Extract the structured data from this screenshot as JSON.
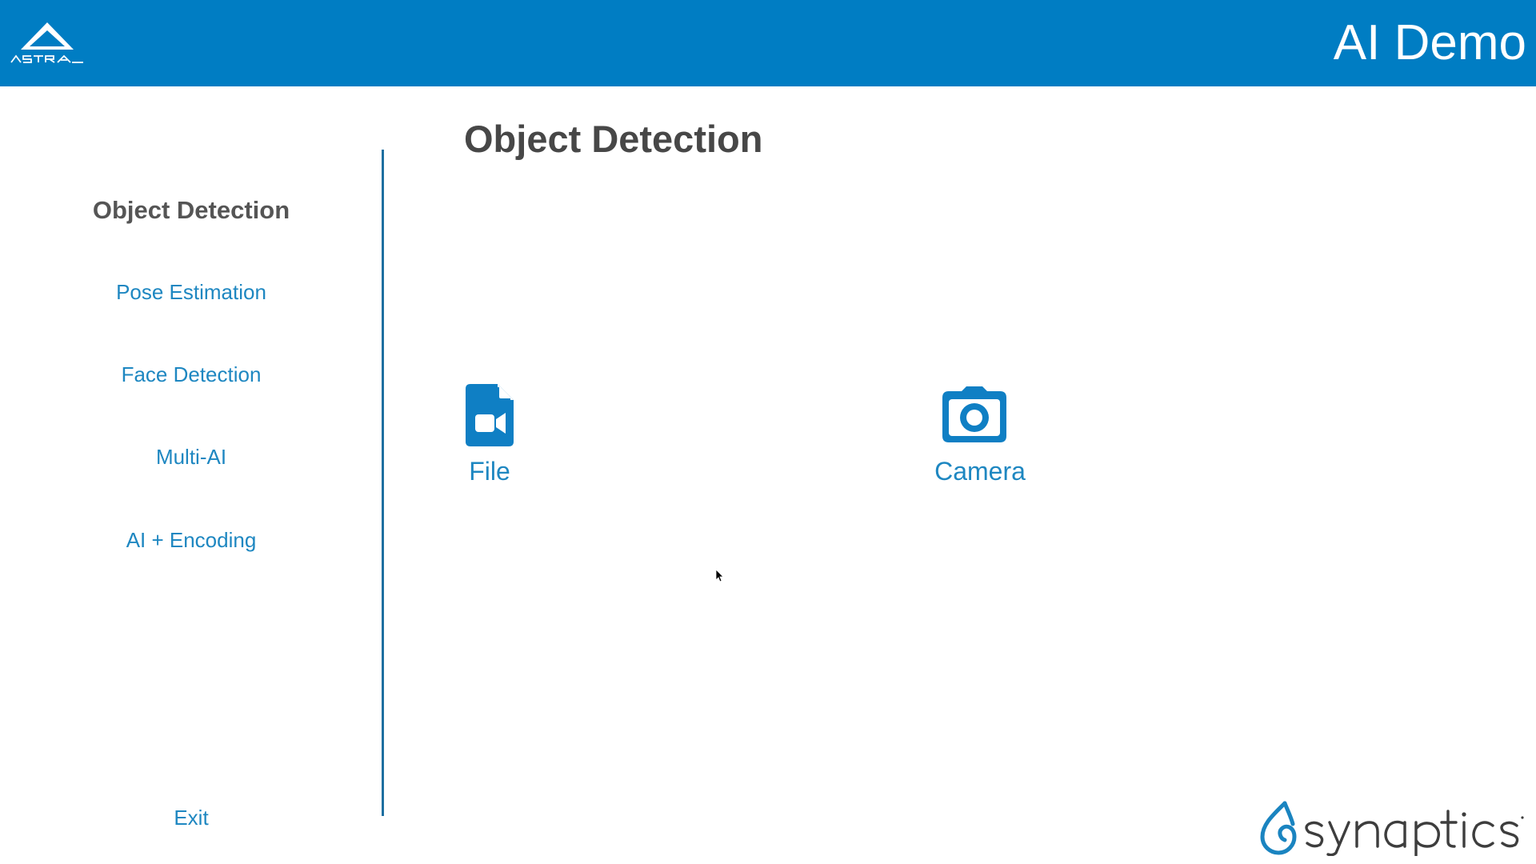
{
  "header": {
    "title": "AI Demo",
    "background_color": "#007dc3",
    "logo_icon": "astra-logo-icon"
  },
  "sidebar": {
    "items": [
      {
        "label": "Object Detection",
        "active": true
      },
      {
        "label": "Pose Estimation",
        "active": false
      },
      {
        "label": "Face Detection",
        "active": false
      },
      {
        "label": "Multi-AI",
        "active": false
      },
      {
        "label": "AI + Encoding",
        "active": false
      }
    ],
    "exit_label": "Exit"
  },
  "main": {
    "title": "Object Detection",
    "sources": [
      {
        "label": "File",
        "icon": "video-file-icon"
      },
      {
        "label": "Camera",
        "icon": "camera-icon"
      }
    ]
  },
  "footer": {
    "brand_icon": "synaptics-logo-icon"
  },
  "colors": {
    "accent": "#1e87c1",
    "active_text": "#555555",
    "title_text": "#474747"
  }
}
